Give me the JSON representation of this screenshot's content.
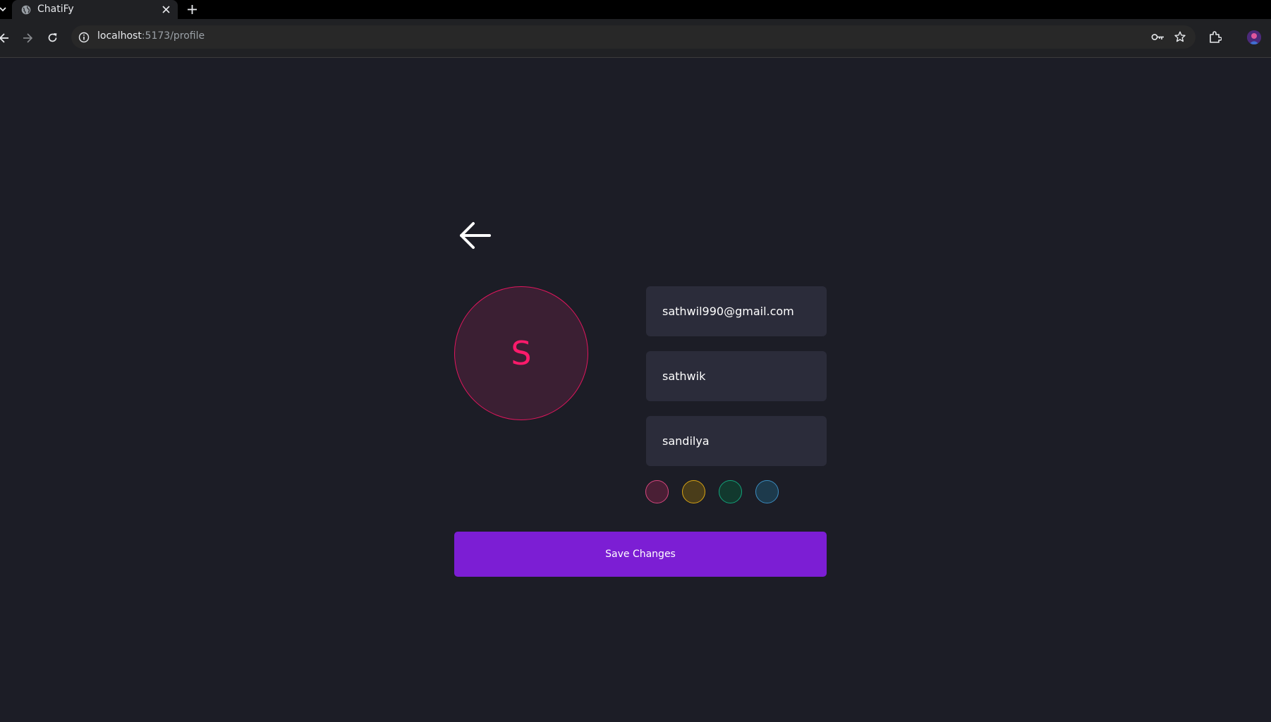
{
  "browser": {
    "tab": {
      "title": "ChatiFy",
      "favicon": "globe-icon"
    },
    "address_bar": {
      "host": "localhost",
      "path": ":5173/profile"
    },
    "icons": [
      "back-arrow-icon",
      "forward-arrow-icon",
      "reload-icon",
      "site-info-icon",
      "key-icon",
      "star-icon",
      "extensions-icon",
      "close-icon",
      "plus-icon"
    ]
  },
  "profile": {
    "back_icon": "arrow-left-icon",
    "avatar": {
      "initial": "S",
      "color": "#ff1a6b",
      "background": "#3b1f33"
    },
    "fields": {
      "email": "sathwil990@gmail.com",
      "first_name": "sathwik",
      "last_name": "sandilya"
    },
    "color_options": [
      {
        "name": "pink",
        "fill": "#4a1f35",
        "border": "#d7457e"
      },
      {
        "name": "yellow",
        "fill": "#4a3d1a",
        "border": "#d9a514"
      },
      {
        "name": "green",
        "fill": "#12392e",
        "border": "#12a37a"
      },
      {
        "name": "blue",
        "fill": "#1d3a4c",
        "border": "#3b8cc0"
      }
    ],
    "save_label": "Save Changes",
    "accent_color": "#7c1ed4"
  }
}
